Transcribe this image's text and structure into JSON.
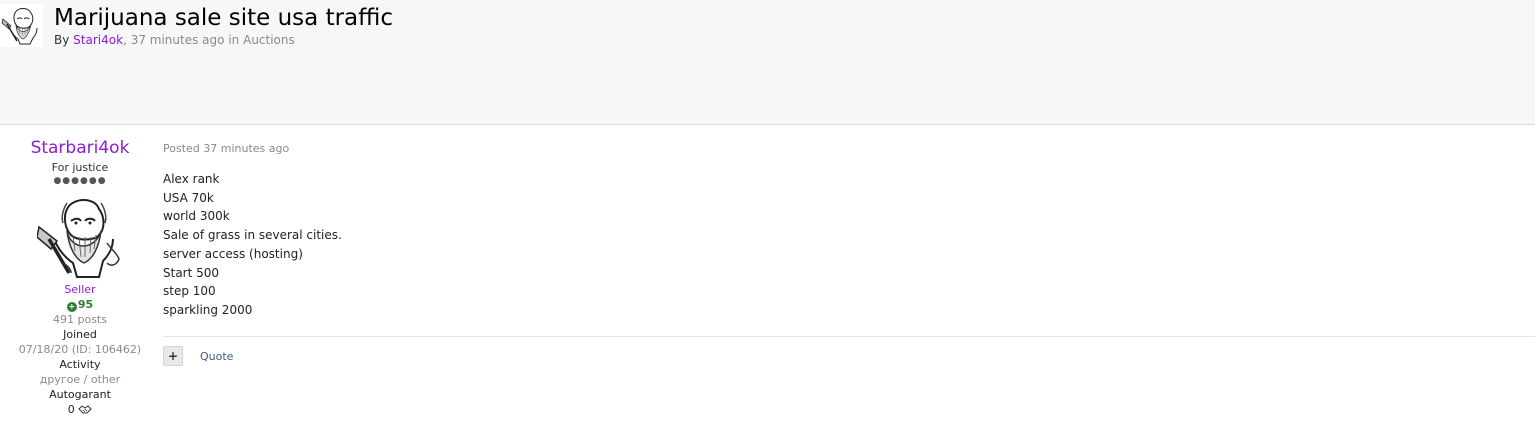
{
  "topic": {
    "title": "Marijuana sale site usa traffic",
    "by_label": "By",
    "author": "Stari4ok",
    "separator": ",",
    "time_ago": "37 minutes ago",
    "in_label": "in",
    "forum": "Auctions"
  },
  "author_panel": {
    "name": "Starbari4ok",
    "member_title": "For justice",
    "rank_pips": "●●●●●●",
    "group": "Seller",
    "reputation": "95",
    "post_count": "491 posts",
    "joined_label": "Joined",
    "joined_value": "07/18/20 (ID: 106462)",
    "activity_label": "Activity",
    "activity_value": "другое / other",
    "autogarant_label": "Autogarant",
    "autogarant_value": "0"
  },
  "post": {
    "date": "Posted 37 minutes ago",
    "lines": [
      "Alex rank",
      "USA 70k",
      "world 300k",
      "Sale of grass in several cities.",
      "server access (hosting)",
      "Start 500",
      "step 100",
      "sparkling 2000"
    ]
  },
  "controls": {
    "plus_label": "+",
    "quote_label": "Quote"
  },
  "icons": {
    "avatar": "old-man-axe-sketch",
    "reputation": "plus-circle-icon",
    "autogarant": "handshake-icon"
  },
  "colors": {
    "username": "#8f1bd6",
    "reputation": "#2f7d32",
    "link": "#3d5a80",
    "header_bg": "#f7f7f7"
  }
}
